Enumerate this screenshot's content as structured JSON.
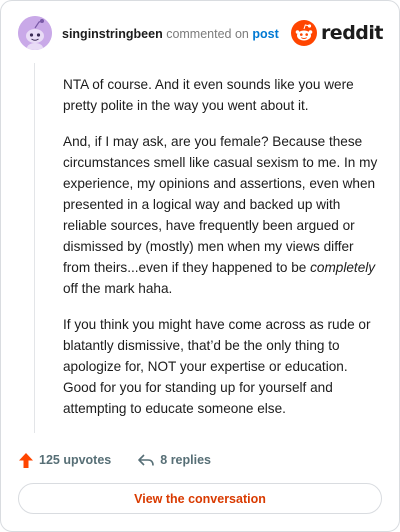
{
  "header": {
    "username": "singinstringbeen",
    "commented_text": "commented on",
    "post_link": "post",
    "logo_text": "reddit"
  },
  "comment": {
    "p1": "NTA of course. And it even sounds like you were pretty polite in the way you went about it.",
    "p2": "And, if I may ask, are you female? Because these circumstances smell like casual sexism to me. In my experience, my opinions and assertions, even when presented in a logical way and backed up with reliable sources, have frequently been argued or dismissed by (mostly) men when my views differ from theirs...even if they happened to be",
    "p2_emphasis": "completely",
    "p2_end": "off the mark haha.",
    "p3": "If you think you might have come across as rude or blatantly dismissive, that’d be the only thing to apologize for, NOT your expertise or education. Good for you for standing up for yourself and attempting to educate someone else."
  },
  "actions": {
    "upvotes": "125 upvotes",
    "replies": "8 replies"
  },
  "view_button": "View the conversation",
  "colors": {
    "accent": "#ff4500",
    "link": "#0079d3",
    "button_text": "#d93a00"
  },
  "icons": {
    "avatar": "snoo-avatar",
    "logo": "reddit-snoo-icon",
    "upvote": "upvote-arrow-icon",
    "reply": "reply-arrow-icon"
  }
}
